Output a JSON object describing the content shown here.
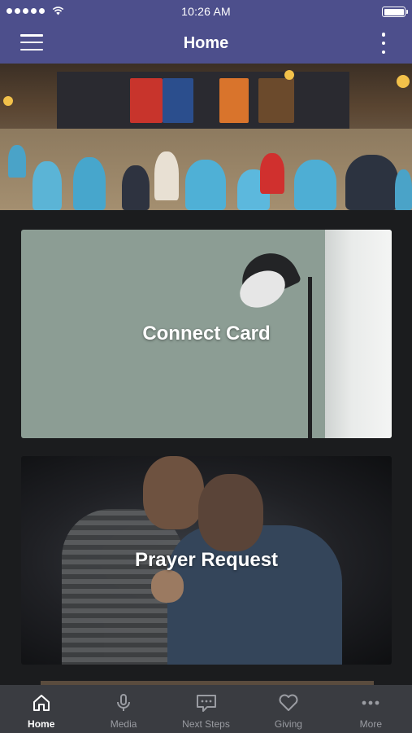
{
  "status_bar": {
    "time": "10:26 AM"
  },
  "header": {
    "title": "Home",
    "menu_icon": "hamburger-menu-icon",
    "overflow_icon": "more-vertical-icon"
  },
  "cards": [
    {
      "label": "Connect Card"
    },
    {
      "label": "Prayer Request"
    }
  ],
  "tabs": [
    {
      "label": "Home",
      "icon": "home-icon",
      "active": true
    },
    {
      "label": "Media",
      "icon": "microphone-icon",
      "active": false
    },
    {
      "label": "Next Steps",
      "icon": "chat-bubble-icon",
      "active": false
    },
    {
      "label": "Giving",
      "icon": "heart-icon",
      "active": false
    },
    {
      "label": "More",
      "icon": "more-horizontal-icon",
      "active": false
    }
  ],
  "colors": {
    "brand": "#4d4f8c",
    "background": "#1b1c1e",
    "tabbar": "#3a3c41",
    "tab_inactive": "#9a9ca2",
    "tab_active": "#ffffff"
  }
}
